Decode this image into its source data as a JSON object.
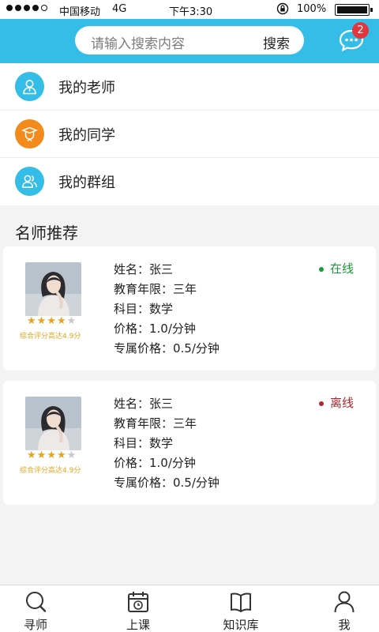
{
  "status_bar": {
    "carrier": "中国移动",
    "network": "4G",
    "time": "下午3:30",
    "battery": "100%"
  },
  "header": {
    "search_placeholder": "请输入搜索内容",
    "search_button": "搜索",
    "message_badge": "2",
    "accent_color": "#34bde6"
  },
  "menu": [
    {
      "label": "我的老师",
      "icon": "teacher-icon",
      "color": "#34bde6"
    },
    {
      "label": "我的同学",
      "icon": "classmate-icon",
      "color": "#f28a1c"
    },
    {
      "label": "我的群组",
      "icon": "group-icon",
      "color": "#34bde6"
    }
  ],
  "section_title": "名师推荐",
  "teachers": [
    {
      "name_line": "姓名：张三",
      "years_line": "教育年限：三年",
      "subject_line": "科目：数学",
      "price_line": "价格：1.0/分钟",
      "vip_price_line": "专属价格：0.5/分钟",
      "status": "在线",
      "status_color": "#1a9a3a",
      "rating": 4,
      "rating_max": 5,
      "rating_note": "综合评分高达4.9分"
    },
    {
      "name_line": "姓名：张三",
      "years_line": "教育年限：三年",
      "subject_line": "科目：数学",
      "price_line": "价格：1.0/分钟",
      "vip_price_line": "专属价格：0.5/分钟",
      "status": "离线",
      "status_color": "#b3262d",
      "rating": 4,
      "rating_max": 5,
      "rating_note": "综合评分高达4.9分"
    }
  ],
  "tabs": [
    {
      "label": "寻师",
      "icon": "search-icon"
    },
    {
      "label": "上课",
      "icon": "calendar-icon"
    },
    {
      "label": "知识库",
      "icon": "book-icon"
    },
    {
      "label": "我",
      "icon": "person-icon"
    }
  ]
}
